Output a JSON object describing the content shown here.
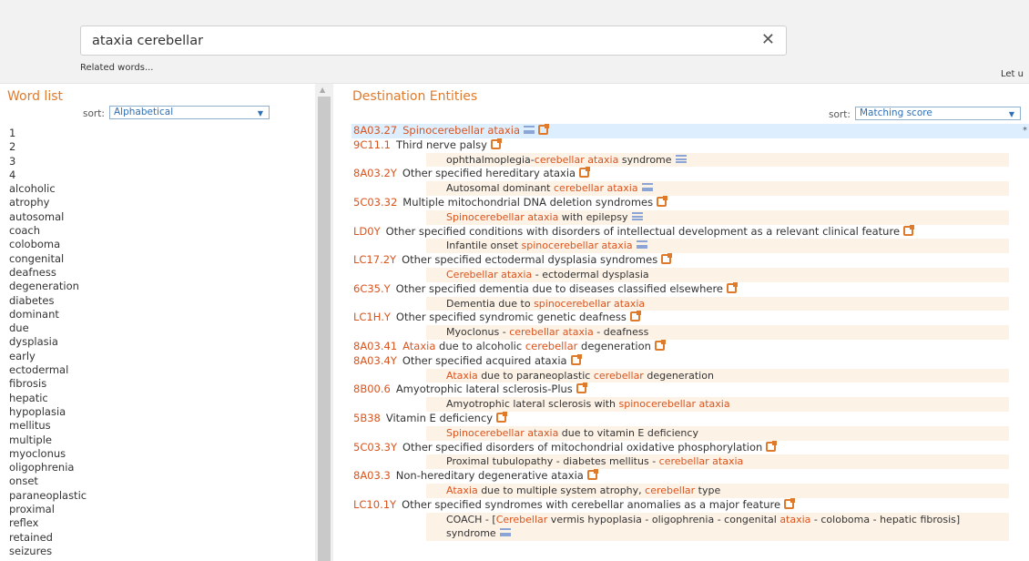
{
  "search": {
    "value": "ataxia cerebellar",
    "clear_label": "✕"
  },
  "related_words_label": "Related words...",
  "let_label": "Let u",
  "word_list": {
    "title": "Word list",
    "sort_label": "sort:",
    "sort_value": "Alphabetical",
    "words": [
      "1",
      "2",
      "3",
      "4",
      "alcoholic",
      "atrophy",
      "autosomal",
      "coach",
      "coloboma",
      "congenital",
      "deafness",
      "degeneration",
      "diabetes",
      "dominant",
      "due",
      "dysplasia",
      "early",
      "ectodermal",
      "fibrosis",
      "hepatic",
      "hypoplasia",
      "mellitus",
      "multiple",
      "myoclonus",
      "oligophrenia",
      "onset",
      "paraneoplastic",
      "proximal",
      "reflex",
      "retained",
      "seizures"
    ]
  },
  "destination": {
    "title": "Destination Entities",
    "sort_label": "sort:",
    "sort_value": "Matching score",
    "rows": [
      {
        "type": "main",
        "code": "8A03.27",
        "selected": true,
        "ext": true,
        "menu": true,
        "star": "*",
        "parts": [
          {
            "t": "Spinocerebellar ataxia",
            "h": true
          }
        ]
      },
      {
        "type": "main",
        "code": "9C11.1",
        "ext": true,
        "parts": [
          {
            "t": "Third nerve palsy"
          }
        ]
      },
      {
        "type": "sub",
        "menu": true,
        "parts": [
          {
            "t": "ophthalmoplegia-"
          },
          {
            "t": "cerebellar ataxia",
            "h": true
          },
          {
            "t": " syndrome"
          }
        ]
      },
      {
        "type": "main",
        "code": "8A03.2Y",
        "ext": true,
        "parts": [
          {
            "t": "Other specified hereditary ataxia"
          }
        ]
      },
      {
        "type": "sub",
        "menu": true,
        "parts": [
          {
            "t": "Autosomal dominant "
          },
          {
            "t": "cerebellar ataxia",
            "h": true
          }
        ]
      },
      {
        "type": "main",
        "code": "5C03.32",
        "ext": true,
        "parts": [
          {
            "t": "Multiple mitochondrial DNA deletion syndromes"
          }
        ]
      },
      {
        "type": "sub",
        "menu": true,
        "parts": [
          {
            "t": "Spinocerebellar ataxia",
            "h": true
          },
          {
            "t": " with epilepsy"
          }
        ]
      },
      {
        "type": "main",
        "code": "LD0Y",
        "ext": true,
        "parts": [
          {
            "t": "Other specified conditions with disorders of intellectual development as a relevant clinical feature"
          }
        ]
      },
      {
        "type": "sub",
        "menu": true,
        "parts": [
          {
            "t": "Infantile onset "
          },
          {
            "t": "spinocerebellar ataxia",
            "h": true
          }
        ]
      },
      {
        "type": "main",
        "code": "LC17.2Y",
        "ext": true,
        "parts": [
          {
            "t": "Other specified ectodermal dysplasia syndromes"
          }
        ]
      },
      {
        "type": "sub",
        "parts": [
          {
            "t": "Cerebellar ataxia",
            "h": true
          },
          {
            "t": " - ectodermal dysplasia"
          }
        ]
      },
      {
        "type": "main",
        "code": "6C35.Y",
        "ext": true,
        "parts": [
          {
            "t": "Other specified dementia due to diseases classified elsewhere"
          }
        ]
      },
      {
        "type": "sub",
        "parts": [
          {
            "t": "Dementia due to "
          },
          {
            "t": "spinocerebellar ataxia",
            "h": true
          }
        ]
      },
      {
        "type": "main",
        "code": "LC1H.Y",
        "ext": true,
        "parts": [
          {
            "t": "Other specified syndromic genetic deafness"
          }
        ]
      },
      {
        "type": "sub",
        "parts": [
          {
            "t": "Myoclonus - "
          },
          {
            "t": "cerebellar ataxia",
            "h": true
          },
          {
            "t": " - deafness"
          }
        ]
      },
      {
        "type": "main",
        "code": "8A03.41",
        "ext": true,
        "parts": [
          {
            "t": "Ataxia",
            "h": true
          },
          {
            "t": " due to alcoholic "
          },
          {
            "t": "cerebellar",
            "h": true
          },
          {
            "t": " degeneration"
          }
        ]
      },
      {
        "type": "main",
        "code": "8A03.4Y",
        "ext": true,
        "parts": [
          {
            "t": "Other specified acquired ataxia"
          }
        ]
      },
      {
        "type": "sub",
        "parts": [
          {
            "t": "Ataxia",
            "h": true
          },
          {
            "t": " due to paraneoplastic "
          },
          {
            "t": "cerebellar",
            "h": true
          },
          {
            "t": " degeneration"
          }
        ]
      },
      {
        "type": "main",
        "code": "8B00.6",
        "ext": true,
        "parts": [
          {
            "t": "Amyotrophic lateral sclerosis-Plus"
          }
        ]
      },
      {
        "type": "sub",
        "parts": [
          {
            "t": "Amyotrophic lateral sclerosis with "
          },
          {
            "t": "spinocerebellar ataxia",
            "h": true
          }
        ]
      },
      {
        "type": "main",
        "code": "5B38",
        "ext": true,
        "parts": [
          {
            "t": "Vitamin E deficiency"
          }
        ]
      },
      {
        "type": "sub",
        "parts": [
          {
            "t": "Spinocerebellar ataxia",
            "h": true
          },
          {
            "t": " due to vitamin E deficiency"
          }
        ]
      },
      {
        "type": "main",
        "code": "5C03.3Y",
        "ext": true,
        "parts": [
          {
            "t": "Other specified disorders of mitochondrial oxidative phosphorylation"
          }
        ]
      },
      {
        "type": "sub",
        "parts": [
          {
            "t": "Proximal tubulopathy - diabetes mellitus - "
          },
          {
            "t": "cerebellar ataxia",
            "h": true
          }
        ]
      },
      {
        "type": "main",
        "code": "8A03.3",
        "ext": true,
        "parts": [
          {
            "t": "Non-hereditary degenerative ataxia"
          }
        ]
      },
      {
        "type": "sub",
        "parts": [
          {
            "t": "Ataxia",
            "h": true
          },
          {
            "t": " due to multiple system atrophy, "
          },
          {
            "t": "cerebellar",
            "h": true
          },
          {
            "t": " type"
          }
        ]
      },
      {
        "type": "main",
        "code": "LC10.1Y",
        "ext": true,
        "parts": [
          {
            "t": "Other specified syndromes with cerebellar anomalies as a major feature"
          }
        ]
      },
      {
        "type": "sub",
        "menu": true,
        "parts": [
          {
            "t": "COACH - ["
          },
          {
            "t": "Cerebellar",
            "h": true
          },
          {
            "t": " vermis hypoplasia - oligophrenia - congenital "
          },
          {
            "t": "ataxia",
            "h": true
          },
          {
            "t": " - coloboma - hepatic fibrosis] syndrome"
          }
        ]
      }
    ]
  }
}
